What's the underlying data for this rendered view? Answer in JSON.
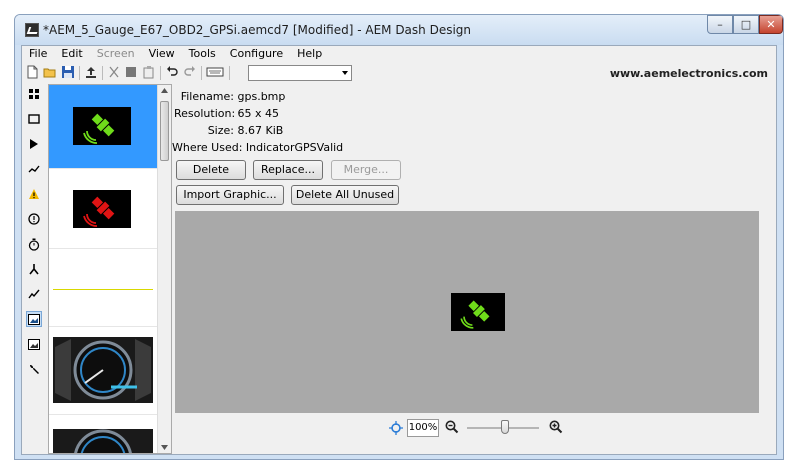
{
  "window": {
    "title": "*AEM_5_Gauge_E67_OBD2_GPSi.aemcd7 [Modified] - AEM Dash Design",
    "controls": {
      "minimize": "–",
      "maximize": "□",
      "close": "✕"
    }
  },
  "menu": [
    "File",
    "Edit",
    "Screen",
    "View",
    "Tools",
    "Configure",
    "Help"
  ],
  "menu_disabled": [
    "Screen"
  ],
  "toolbar": {
    "dropdown_value": "",
    "website": "www.aemelectronics.com"
  },
  "sidebar_icons": [
    "grid-icon",
    "rectangle-icon",
    "play-icon",
    "line-chart-icon",
    "warning-icon",
    "alert-circle-icon",
    "stopwatch-icon",
    "branch-icon",
    "trend-icon",
    "image-icon",
    "image-alt-icon",
    "wrench-icon"
  ],
  "file_info": {
    "filename_label": "Filename:",
    "filename": "gps.bmp",
    "resolution_label": "Resolution:",
    "resolution": "65 x 45",
    "size_label": "Size:",
    "size": "8.67 KiB",
    "where_used_label": "Where Used:",
    "where_used": "IndicatorGPSValid"
  },
  "buttons": {
    "delete": "Delete",
    "replace": "Replace...",
    "merge": "Merge...",
    "import": "Import Graphic...",
    "delete_unused": "Delete All Unused"
  },
  "zoom": {
    "value": "100%",
    "level": 0.5
  },
  "colors": {
    "selection": "#3399ff",
    "gps_green": "#6fdc1a",
    "gps_red": "#e01414",
    "preview_bg": "#a9a9a9"
  }
}
